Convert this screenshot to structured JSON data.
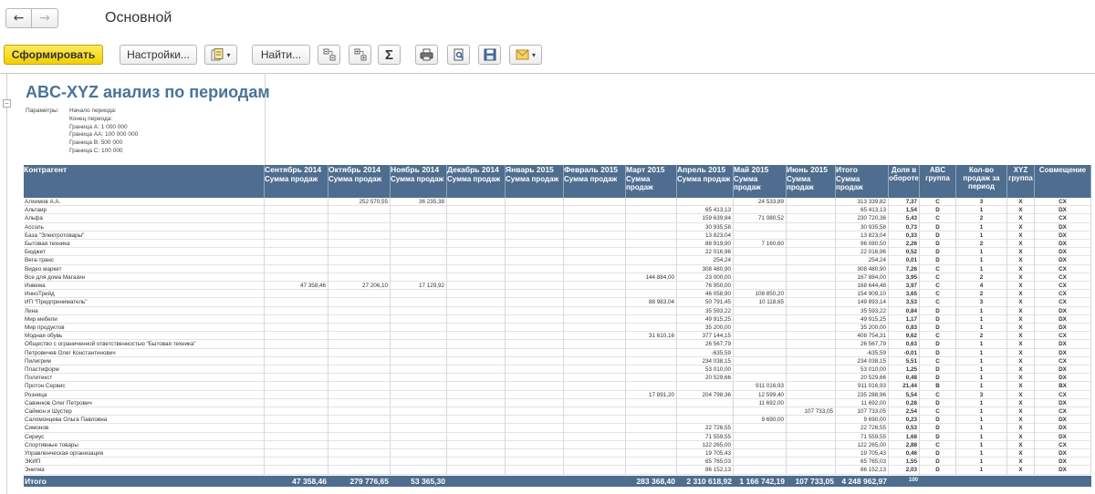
{
  "window": {
    "title": "Основной"
  },
  "nav": {
    "back_icon": "←",
    "forward_icon": "→"
  },
  "toolbar": {
    "generate_label": "Сформировать",
    "settings_label": "Настройки...",
    "find_label": "Найти...",
    "sum_icon": "Σ",
    "caret": "▾"
  },
  "report": {
    "title": "ABC-XYZ анализ по периодам",
    "params_label": "Параметры:",
    "params": [
      "Начало периода:",
      "Конец периода:",
      "Граница А: 1 000 000",
      "Граница АА: 100 000 000",
      "Граница В: 500 000",
      "Граница С: 100 000"
    ]
  },
  "table": {
    "header_name": "Контрагент",
    "months": [
      "Сентябрь 2014",
      "Октябрь 2014",
      "Ноябрь 2014",
      "Декабрь 2014",
      "Январь 2015",
      "Февраль 2015",
      "Март 2015",
      "Апрель 2015",
      "Май 2015",
      "Июнь 2015",
      "Итого"
    ],
    "sub_label": "Сумма продаж",
    "extra_headers": [
      "Доля в обороте",
      "ABC группа",
      "Кол-во продаж за период",
      "XYZ группа",
      "Совмещение"
    ],
    "rows": [
      {
        "name": "Алхимов А.А.",
        "v": [
          "",
          "252 570,55",
          "36 235,38",
          "",
          "",
          "",
          "",
          "",
          "24 533,89",
          "",
          ""
        ],
        "total": "313 339,82",
        "share": "7,37",
        "abc": "C",
        "cnt": "3",
        "xyz": "X",
        "comb": "CX"
      },
      {
        "name": "Альтаир",
        "v": [
          "",
          "",
          "",
          "",
          "",
          "",
          "",
          "65 413,13",
          "",
          "",
          ""
        ],
        "total": "65 413,13",
        "share": "1,54",
        "abc": "D",
        "cnt": "1",
        "xyz": "X",
        "comb": "DX"
      },
      {
        "name": "Альфа",
        "v": [
          "",
          "",
          "",
          "",
          "",
          "",
          "",
          "159 639,84",
          "71 080,52",
          "",
          ""
        ],
        "total": "230 720,36",
        "share": "5,43",
        "abc": "C",
        "cnt": "2",
        "xyz": "X",
        "comb": "CX"
      },
      {
        "name": "Ассоль",
        "v": [
          "",
          "",
          "",
          "",
          "",
          "",
          "",
          "30 935,58",
          "",
          "",
          ""
        ],
        "total": "30 935,58",
        "share": "0,73",
        "abc": "D",
        "cnt": "1",
        "xyz": "X",
        "comb": "DX"
      },
      {
        "name": "База \"Электротовары\"",
        "v": [
          "",
          "",
          "",
          "",
          "",
          "",
          "",
          "13 823,04",
          "",
          "",
          ""
        ],
        "total": "13 823,04",
        "share": "0,33",
        "abc": "D",
        "cnt": "1",
        "xyz": "X",
        "comb": "DX"
      },
      {
        "name": "Бытовая техника",
        "v": [
          "",
          "",
          "",
          "",
          "",
          "",
          "",
          "88 919,90",
          "7 160,60",
          "",
          ""
        ],
        "total": "96 080,50",
        "share": "2,26",
        "abc": "D",
        "cnt": "2",
        "xyz": "X",
        "comb": "DX"
      },
      {
        "name": "Бюджет",
        "v": [
          "",
          "",
          "",
          "",
          "",
          "",
          "",
          "22 016,96",
          "",
          "",
          ""
        ],
        "total": "22 016,96",
        "share": "0,52",
        "abc": "D",
        "cnt": "1",
        "xyz": "X",
        "comb": "DX"
      },
      {
        "name": "Вега-транс",
        "v": [
          "",
          "",
          "",
          "",
          "",
          "",
          "",
          "254,24",
          "",
          "",
          ""
        ],
        "total": "254,24",
        "share": "0,01",
        "abc": "D",
        "cnt": "1",
        "xyz": "X",
        "comb": "DX"
      },
      {
        "name": "Видео маркет",
        "v": [
          "",
          "",
          "",
          "",
          "",
          "",
          "",
          "308 480,90",
          "",
          "",
          ""
        ],
        "total": "308 480,90",
        "share": "7,26",
        "abc": "C",
        "cnt": "1",
        "xyz": "X",
        "comb": "CX"
      },
      {
        "name": "Все для дома Магазин",
        "v": [
          "",
          "",
          "",
          "",
          "",
          "",
          "144 884,00",
          "23 000,00",
          "",
          "",
          ""
        ],
        "total": "167 884,00",
        "share": "3,95",
        "abc": "C",
        "cnt": "2",
        "xyz": "X",
        "comb": "CX"
      },
      {
        "name": "Инвема",
        "v": [
          "47 358,46",
          "27 206,10",
          "17 129,92",
          "",
          "",
          "",
          "",
          "76 950,00",
          "",
          "",
          ""
        ],
        "total": "168 644,48",
        "share": "3,97",
        "abc": "C",
        "cnt": "4",
        "xyz": "X",
        "comb": "CX"
      },
      {
        "name": "ИнноТрейд",
        "v": [
          "",
          "",
          "",
          "",
          "",
          "",
          "",
          "46 058,90",
          "108 850,20",
          "",
          ""
        ],
        "total": "154 909,10",
        "share": "3,65",
        "abc": "C",
        "cnt": "2",
        "xyz": "X",
        "comb": "CX"
      },
      {
        "name": "ИП \"Предприниматель\"",
        "v": [
          "",
          "",
          "",
          "",
          "",
          "",
          "88 983,04",
          "50 791,45",
          "10 118,65",
          "",
          ""
        ],
        "total": "149 893,14",
        "share": "3,53",
        "abc": "C",
        "cnt": "3",
        "xyz": "X",
        "comb": "CX"
      },
      {
        "name": "Лина",
        "v": [
          "",
          "",
          "",
          "",
          "",
          "",
          "",
          "35 593,22",
          "",
          "",
          ""
        ],
        "total": "35 593,22",
        "share": "0,84",
        "abc": "D",
        "cnt": "1",
        "xyz": "X",
        "comb": "DX"
      },
      {
        "name": "Мир мебели",
        "v": [
          "",
          "",
          "",
          "",
          "",
          "",
          "",
          "49 915,25",
          "",
          "",
          ""
        ],
        "total": "49 915,25",
        "share": "1,17",
        "abc": "D",
        "cnt": "1",
        "xyz": "X",
        "comb": "DX"
      },
      {
        "name": "Мир продуктов",
        "v": [
          "",
          "",
          "",
          "",
          "",
          "",
          "",
          "35 200,00",
          "",
          "",
          ""
        ],
        "total": "35 200,00",
        "share": "0,83",
        "abc": "D",
        "cnt": "1",
        "xyz": "X",
        "comb": "DX"
      },
      {
        "name": "Модная обувь",
        "v": [
          "",
          "",
          "",
          "",
          "",
          "",
          "31 610,16",
          "377 144,15",
          "",
          "",
          ""
        ],
        "total": "408 754,31",
        "share": "9,62",
        "abc": "C",
        "cnt": "2",
        "xyz": "X",
        "comb": "CX"
      },
      {
        "name": "Общество с ограниченной ответственностью \"Бытовая техника\"",
        "v": [
          "",
          "",
          "",
          "",
          "",
          "",
          "",
          "26 567,79",
          "",
          "",
          ""
        ],
        "total": "26 567,79",
        "share": "0,63",
        "abc": "D",
        "cnt": "1",
        "xyz": "X",
        "comb": "DX"
      },
      {
        "name": "Петровичев Олег Константинович",
        "v": [
          "",
          "",
          "",
          "",
          "",
          "",
          "",
          "-635,59",
          "",
          "",
          ""
        ],
        "total": "-635,59",
        "share": "-0,01",
        "abc": "D",
        "cnt": "1",
        "xyz": "X",
        "comb": "DX"
      },
      {
        "name": "Пилигрим",
        "v": [
          "",
          "",
          "",
          "",
          "",
          "",
          "",
          "234 038,15",
          "",
          "",
          ""
        ],
        "total": "234 038,15",
        "share": "5,51",
        "abc": "C",
        "cnt": "1",
        "xyz": "X",
        "comb": "CX"
      },
      {
        "name": "Пластиформ",
        "v": [
          "",
          "",
          "",
          "",
          "",
          "",
          "",
          "53 010,00",
          "",
          "",
          ""
        ],
        "total": "53 010,00",
        "share": "1,25",
        "abc": "D",
        "cnt": "1",
        "xyz": "X",
        "comb": "DX"
      },
      {
        "name": "Политекст",
        "v": [
          "",
          "",
          "",
          "",
          "",
          "",
          "",
          "20 529,66",
          "",
          "",
          ""
        ],
        "total": "20 529,66",
        "share": "0,48",
        "abc": "D",
        "cnt": "1",
        "xyz": "X",
        "comb": "DX"
      },
      {
        "name": "Протон Сервис",
        "v": [
          "",
          "",
          "",
          "",
          "",
          "",
          "",
          "",
          "911 016,93",
          "",
          ""
        ],
        "total": "911 016,93",
        "share": "21,44",
        "abc": "B",
        "cnt": "1",
        "xyz": "X",
        "comb": "BX"
      },
      {
        "name": "Розница",
        "v": [
          "",
          "",
          "",
          "",
          "",
          "",
          "17 891,20",
          "204 798,36",
          "12 599,40",
          "",
          ""
        ],
        "total": "235 288,96",
        "share": "5,54",
        "abc": "C",
        "cnt": "3",
        "xyz": "X",
        "comb": "CX"
      },
      {
        "name": "Савинков Олег Петрович",
        "v": [
          "",
          "",
          "",
          "",
          "",
          "",
          "",
          "",
          "11 692,00",
          "",
          ""
        ],
        "total": "11 692,00",
        "share": "0,28",
        "abc": "D",
        "cnt": "1",
        "xyz": "X",
        "comb": "DX"
      },
      {
        "name": "Саймон и Шустер",
        "v": [
          "",
          "",
          "",
          "",
          "",
          "",
          "",
          "",
          "",
          "107 733,05",
          ""
        ],
        "total": "107 733,05",
        "share": "2,54",
        "abc": "C",
        "cnt": "1",
        "xyz": "X",
        "comb": "CX"
      },
      {
        "name": "Саломонцева Ольга Павловна",
        "v": [
          "",
          "",
          "",
          "",
          "",
          "",
          "",
          "",
          "9 690,00",
          "",
          ""
        ],
        "total": "9 690,00",
        "share": "0,23",
        "abc": "D",
        "cnt": "1",
        "xyz": "X",
        "comb": "DX"
      },
      {
        "name": "Симонов",
        "v": [
          "",
          "",
          "",
          "",
          "",
          "",
          "",
          "22 726,55",
          "",
          "",
          ""
        ],
        "total": "22 726,55",
        "share": "0,53",
        "abc": "D",
        "cnt": "1",
        "xyz": "X",
        "comb": "DX"
      },
      {
        "name": "Сириус",
        "v": [
          "",
          "",
          "",
          "",
          "",
          "",
          "",
          "71 559,55",
          "",
          "",
          ""
        ],
        "total": "71 559,55",
        "share": "1,68",
        "abc": "D",
        "cnt": "1",
        "xyz": "X",
        "comb": "DX"
      },
      {
        "name": "Спортивные товары",
        "v": [
          "",
          "",
          "",
          "",
          "",
          "",
          "",
          "122 265,00",
          "",
          "",
          ""
        ],
        "total": "122 265,00",
        "share": "2,88",
        "abc": "C",
        "cnt": "1",
        "xyz": "X",
        "comb": "CX"
      },
      {
        "name": "Управленческая организация",
        "v": [
          "",
          "",
          "",
          "",
          "",
          "",
          "",
          "19 705,43",
          "",
          "",
          ""
        ],
        "total": "19 705,43",
        "share": "0,46",
        "abc": "D",
        "cnt": "1",
        "xyz": "X",
        "comb": "DX"
      },
      {
        "name": "ЭКИП",
        "v": [
          "",
          "",
          "",
          "",
          "",
          "",
          "",
          "65 765,03",
          "",
          "",
          ""
        ],
        "total": "65 765,03",
        "share": "1,55",
        "abc": "D",
        "cnt": "1",
        "xyz": "X",
        "comb": "DX"
      },
      {
        "name": "Энигма",
        "v": [
          "",
          "",
          "",
          "",
          "",
          "",
          "",
          "86 152,13",
          "",
          "",
          ""
        ],
        "total": "86 152,13",
        "share": "2,03",
        "abc": "D",
        "cnt": "1",
        "xyz": "X",
        "comb": "DX"
      }
    ],
    "totals": {
      "label": "Итого",
      "v": [
        "47 358,46",
        "279 776,65",
        "53 365,30",
        "",
        "",
        "",
        "283 368,40",
        "2 310 618,92",
        "1 166 742,19",
        "107 733,05"
      ],
      "total": "4 248 962,97",
      "share": "100"
    }
  }
}
